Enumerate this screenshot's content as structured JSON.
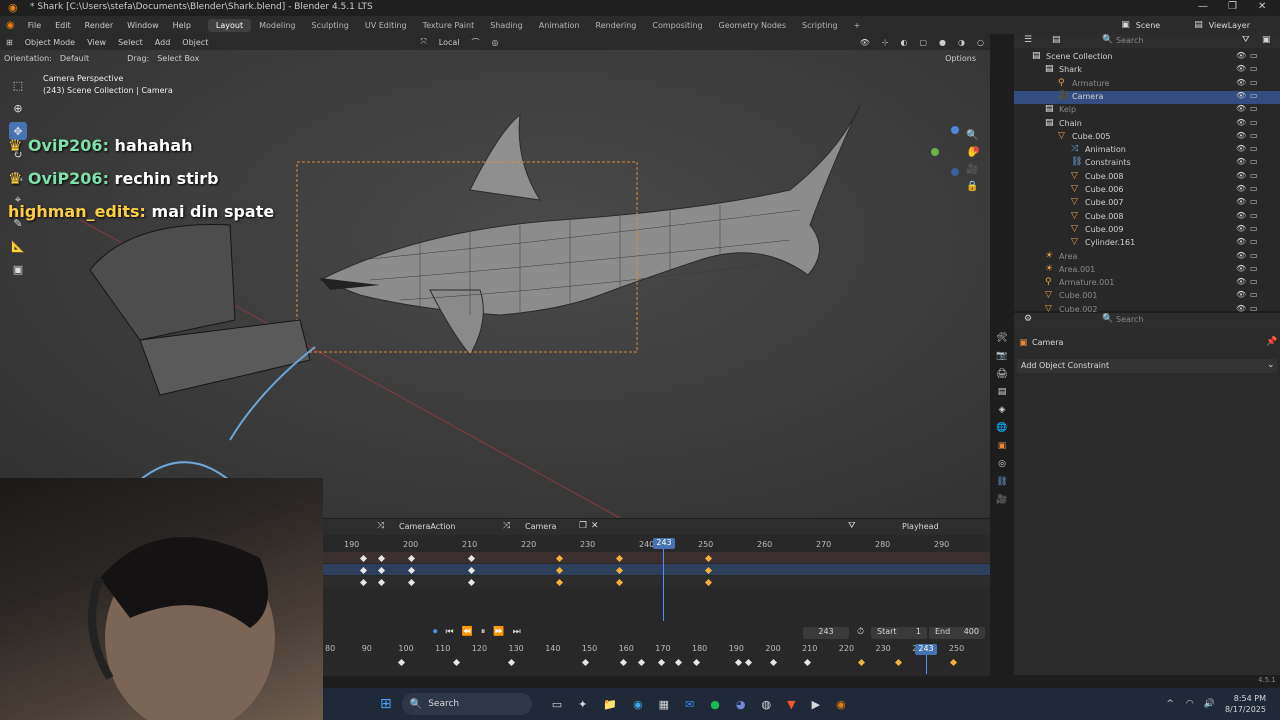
{
  "window": {
    "title": "* Shark [C:\\Users\\stefa\\Documents\\Blender\\Shark.blend] - Blender 4.5.1 LTS"
  },
  "menu": [
    "File",
    "Edit",
    "Render",
    "Window",
    "Help"
  ],
  "workspaces": [
    "Layout",
    "Modeling",
    "Sculpting",
    "UV Editing",
    "Texture Paint",
    "Shading",
    "Animation",
    "Rendering",
    "Compositing",
    "Geometry Nodes",
    "Scripting"
  ],
  "active_workspace": "Layout",
  "scene": {
    "name": "Scene",
    "view_layer": "ViewLayer"
  },
  "viewport_header": {
    "mode": "Object Mode",
    "menus": [
      "View",
      "Select",
      "Add",
      "Object"
    ],
    "transform_space": "Local",
    "orientation_label": "Orientation:",
    "orientation_value": "Default",
    "drag_label": "Drag:",
    "drag_value": "Select Box",
    "options": "Options"
  },
  "viewport_info": {
    "line1": "Camera Perspective",
    "line2": "(243) Scene Collection | Camera"
  },
  "chat": [
    {
      "user": "OviP206",
      "msg": "hahahah"
    },
    {
      "user": "OviP206",
      "msg": "rechin stirb"
    },
    {
      "user": "highman_edits",
      "msg": "mai din spate"
    }
  ],
  "outliner": {
    "search_placeholder": "Search",
    "rows": [
      {
        "label": "Scene Collection",
        "indent": 0,
        "icon": "collection-icon"
      },
      {
        "label": "Shark",
        "indent": 1,
        "icon": "collection-icon"
      },
      {
        "label": "Armature",
        "indent": 2,
        "icon": "armature-icon",
        "dim": true
      },
      {
        "label": "Camera",
        "indent": 2,
        "icon": "camera-icon",
        "selected": true
      },
      {
        "label": "Kelp",
        "indent": 1,
        "icon": "collection-icon",
        "dim": true
      },
      {
        "label": "Chain",
        "indent": 1,
        "icon": "collection-icon"
      },
      {
        "label": "Cube.005",
        "indent": 2,
        "icon": "mesh-icon"
      },
      {
        "label": "Animation",
        "indent": 3,
        "icon": "animation-icon"
      },
      {
        "label": "Constraints",
        "indent": 3,
        "icon": "constraint-icon"
      },
      {
        "label": "Cube.008",
        "indent": 3,
        "icon": "mesh-icon"
      },
      {
        "label": "Cube.006",
        "indent": 3,
        "icon": "mesh-icon"
      },
      {
        "label": "Cube.007",
        "indent": 3,
        "icon": "mesh-icon"
      },
      {
        "label": "Cube.008",
        "indent": 3,
        "icon": "mesh-icon"
      },
      {
        "label": "Cube.009",
        "indent": 3,
        "icon": "mesh-icon"
      },
      {
        "label": "Cylinder.161",
        "indent": 3,
        "icon": "mesh-icon"
      },
      {
        "label": "Area",
        "indent": 1,
        "icon": "light-icon",
        "dim": true
      },
      {
        "label": "Area.001",
        "indent": 1,
        "icon": "light-icon",
        "dim": true
      },
      {
        "label": "Armature.001",
        "indent": 1,
        "icon": "armature-icon",
        "dim": true
      },
      {
        "label": "Cube.001",
        "indent": 1,
        "icon": "mesh-icon",
        "dim": true
      },
      {
        "label": "Cube.002",
        "indent": 1,
        "icon": "mesh-icon",
        "dim": true
      }
    ]
  },
  "properties": {
    "search_placeholder": "Search",
    "object_name": "Camera",
    "add_constraint": "Add Object Constraint"
  },
  "dopesheet": {
    "action": "CameraAction",
    "object": "Camera",
    "playhead_label": "Playhead",
    "ticks": [
      "190",
      "200",
      "210",
      "220",
      "230",
      "240",
      "250",
      "260",
      "270",
      "280",
      "290"
    ],
    "current_frame": "243"
  },
  "timeline": {
    "current_frame": "243",
    "start_label": "Start",
    "start": "1",
    "end_label": "End",
    "end": "400",
    "ticks": [
      "80",
      "90",
      "100",
      "110",
      "120",
      "130",
      "140",
      "150",
      "160",
      "170",
      "180",
      "190",
      "200",
      "210",
      "220",
      "230",
      "240",
      "250"
    ]
  },
  "taskbar": {
    "search": "Search",
    "time": "8:54 PM",
    "date": "8/17/2025"
  },
  "status": {
    "version": "4.5.1"
  },
  "colors": {
    "accent": "#4772b3",
    "keyframe_selected": "#f2b13b",
    "camera_frame": "#e08a3c"
  }
}
